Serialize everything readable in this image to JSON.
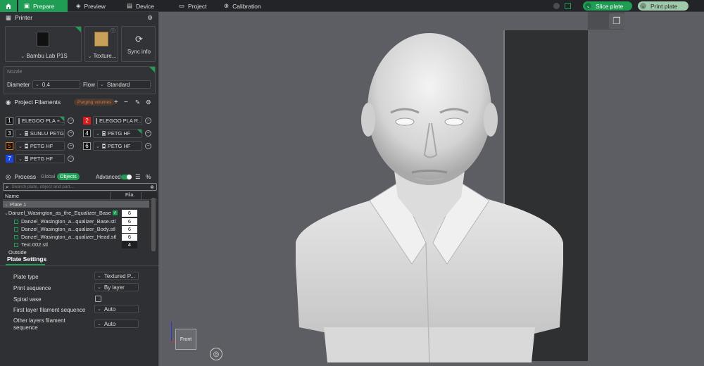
{
  "topbar": {
    "tabs": [
      {
        "label": "Prepare"
      },
      {
        "label": "Preview"
      },
      {
        "label": "Device"
      },
      {
        "label": "Project"
      },
      {
        "label": "Calibration"
      }
    ],
    "slice_label": "Slice plate",
    "print_label": "Print plate"
  },
  "printer": {
    "title": "Printer",
    "name": "Bambu Lab P1S",
    "plate": "Texture...",
    "sync": "Sync info"
  },
  "nozzle": {
    "title": "Nozzle",
    "diameter_label": "Diameter",
    "diameter": "0.4",
    "flow_label": "Flow",
    "flow": "Standard"
  },
  "filaments": {
    "title": "Project Filaments",
    "purge_label": "Purging volumes",
    "items": [
      {
        "num": "1",
        "name": "ELEGOO PLA +...",
        "color": "#111111"
      },
      {
        "num": "2",
        "name": "ELEGOO PLA R...",
        "color": "#e01818"
      },
      {
        "num": "3",
        "name": "SUNLU PETG",
        "color": "#f4f4f4"
      },
      {
        "num": "4",
        "name": "PETG HF",
        "color": "#111111"
      },
      {
        "num": "5",
        "name": "PETG HF",
        "color": "#e07a10"
      },
      {
        "num": "6",
        "name": "PETG HF",
        "color": "#f4f4f4"
      },
      {
        "num": "7",
        "name": "PETG HF",
        "color": "#1846e8"
      }
    ]
  },
  "process": {
    "title": "Process",
    "global": "Global",
    "objects": "Objects",
    "advanced": "Advanced",
    "search_placeholder": "Search plate, object and part..."
  },
  "objects": {
    "col_name": "Name",
    "col_fila": "Fila.",
    "plate": "Plate 1",
    "rows": [
      {
        "name": "Danzel_Wasington_as_the_Equalizer_Base",
        "fila": "6"
      },
      {
        "name": "Danzel_Wasington_a...qualizer_Base.stl",
        "fila": "6"
      },
      {
        "name": "Danzel_Wasington_a...qualizer_Body.stl",
        "fila": "6"
      },
      {
        "name": "Danzel_Wasington_a...qualizer_Head.stl",
        "fila": "6"
      },
      {
        "name": "Text.002.stl",
        "fila": "4"
      }
    ],
    "outside": "Outside"
  },
  "plate_settings": {
    "title": "Plate Settings",
    "rows": [
      {
        "label": "Plate type",
        "value": "Textured P..."
      },
      {
        "label": "Print sequence",
        "value": "By layer"
      },
      {
        "label": "Spiral vase",
        "value": ""
      },
      {
        "label": "First layer filament sequence",
        "value": "Auto"
      },
      {
        "label": "Other layers filament sequence",
        "value": "Auto"
      }
    ]
  },
  "viewport": {
    "view_label": "Front"
  },
  "colors": {
    "accent": "#1f9d55",
    "panel": "#2e3033",
    "viewport_bg": "#5d5e63"
  }
}
